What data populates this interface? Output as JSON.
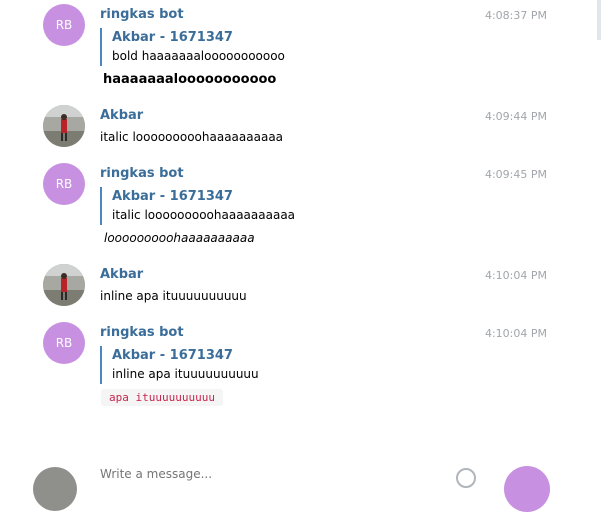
{
  "messages": [
    {
      "sender": "ringkas bot",
      "avatar_initials": "RB",
      "time": "4:08:37 PM",
      "quote_name": "Akbar - 1671347",
      "quote_text": "bold haaaaaaalooooooooooo",
      "body": "haaaaaaalooooooooooo",
      "style": "bold"
    },
    {
      "sender": "Akbar",
      "time": "4:09:44 PM",
      "body": "italic looooooooohaaaaaaaaaa"
    },
    {
      "sender": "ringkas bot",
      "avatar_initials": "RB",
      "time": "4:09:45 PM",
      "quote_name": "Akbar - 1671347",
      "quote_text": "italic looooooooohaaaaaaaaaa",
      "body": "looooooooohaaaaaaaaaa",
      "style": "italic"
    },
    {
      "sender": "Akbar",
      "time": "4:10:04 PM",
      "body": "inline apa ituuuuuuuuuu"
    },
    {
      "sender": "ringkas bot",
      "avatar_initials": "RB",
      "time": "4:10:04 PM",
      "quote_name": "Akbar - 1671347",
      "quote_text": "inline apa ituuuuuuuuuu",
      "body": "apa ituuuuuuuuuu",
      "style": "code"
    }
  ],
  "composer": {
    "placeholder": "Write a message..."
  },
  "colors": {
    "sender": "#3a6d99",
    "bot_avatar": "#c790e0",
    "quote_bar": "#4a86c0",
    "code": "#c7254e",
    "time": "#a0a6ab"
  }
}
